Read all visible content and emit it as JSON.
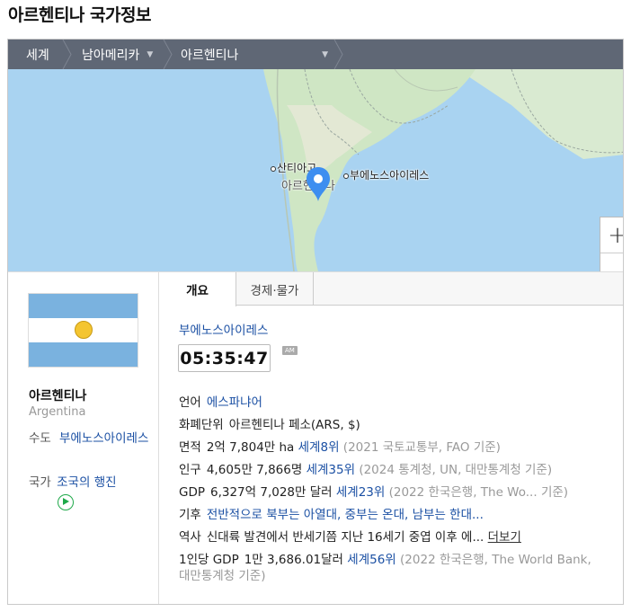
{
  "title": "아르헨티나 국가정보",
  "breadcrumb": {
    "world": "세계",
    "region": "남아메리카",
    "country": "아르헨티나",
    "chevron_icon": "chevron-down-icon"
  },
  "map": {
    "cities": [
      "산티아고",
      "부에노스아이레스"
    ],
    "country_label": "아르헨티나",
    "marker_color": "#3d8ef0",
    "zoom_in": "+",
    "zoom_out": "—"
  },
  "summary": {
    "name": "아르헨티나",
    "name_en": "Argentina",
    "capital_label": "수도",
    "capital": "부에노스아이레스",
    "anthem_label": "국가",
    "anthem": "조국의 행진"
  },
  "tabs": [
    "개요",
    "경제·물가"
  ],
  "clock": {
    "city": "부에노스아이레스",
    "time": "05:35:47",
    "ampm": "AM"
  },
  "facts": {
    "language": {
      "label": "언어",
      "value": "에스파냐어"
    },
    "currency": {
      "label": "화폐단위",
      "value": "아르헨티나 페소(ARS, $)"
    },
    "area": {
      "label": "면적",
      "value": "2억 7,804만 ha",
      "rank": "세계8위",
      "source": "(2021 국토교통부, FAO 기준)"
    },
    "population": {
      "label": "인구",
      "value": "4,605만 7,866명",
      "rank": "세계35위",
      "source": "(2024 통계청, UN, 대만통계청 기준)"
    },
    "gdp": {
      "label": "GDP",
      "value": "6,327억 7,028만 달러",
      "rank": "세계23위",
      "source": "(2022 한국은행, The Wo...",
      "source_tail": "기준)"
    },
    "climate": {
      "label": "기후",
      "value": "전반적으로 북부는 아열대, 중부는 온대, 남부는 한대..."
    },
    "history": {
      "label": "역사",
      "value": "신대륙 발견에서 반세기쯤 지난 16세기 중엽 이후 에...",
      "more": "더보기"
    },
    "gdp_per_capita": {
      "label": "1인당 GDP",
      "value": "1만 3,686.01달러",
      "rank": "세계56위",
      "source": "(2022 한국은행, The World Bank,",
      "source2": "대만통계청 기준)"
    }
  }
}
